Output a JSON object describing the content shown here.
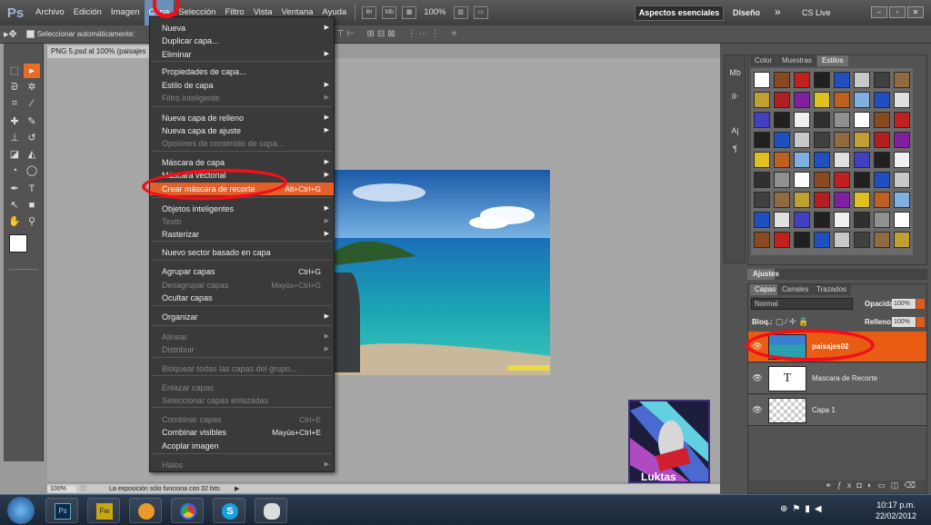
{
  "menubar": {
    "logo": "Ps",
    "items": [
      "Archivo",
      "Edición",
      "Imagen",
      "Capa",
      "Selección",
      "Filtro",
      "Vista",
      "Ventana",
      "Ayuda"
    ],
    "zoom": "100%",
    "workspace": "Aspectos esenciales",
    "design": "Diseño",
    "more": "»",
    "cslive": "CS Live"
  },
  "options": {
    "auto_select": "Seleccionar automáticamente:"
  },
  "document": {
    "tab_title": "PNG 5.psd al 100% (paisajes",
    "status_zoom": "100%",
    "status_text": "La exposición sólo funciona con 32 bits",
    "thumb_name": "Luktas"
  },
  "menu": {
    "items": [
      {
        "label": "Nueva",
        "arrow": true
      },
      {
        "label": "Duplicar capa..."
      },
      {
        "label": "Eliminar",
        "arrow": true
      },
      {
        "label": "Propiedades de capa..."
      },
      {
        "label": "Estilo de capa",
        "arrow": true
      },
      {
        "label": "Filtro inteligente",
        "disabled": true,
        "arrow": true
      },
      {
        "label": "Nueva capa de relleno",
        "arrow": true
      },
      {
        "label": "Nueva capa de ajuste",
        "arrow": true
      },
      {
        "label": "Opciones de contenido de capa...",
        "disabled": true
      },
      {
        "label": "Máscara de capa",
        "arrow": true
      },
      {
        "label": "Máscara vectorial",
        "arrow": true
      },
      {
        "label": "Crear máscara de recorte",
        "shortcut": "Alt+Ctrl+G",
        "highlight": true
      },
      {
        "label": "Objetos inteligentes",
        "arrow": true
      },
      {
        "label": "Texto",
        "disabled": true,
        "arrow": true
      },
      {
        "label": "Rasterizar",
        "arrow": true
      },
      {
        "label": "Nuevo sector basado en capa"
      },
      {
        "label": "Agrupar capas",
        "shortcut": "Ctrl+G"
      },
      {
        "label": "Desagrupar capas",
        "shortcut": "Mayús+Ctrl+G",
        "disabled": true
      },
      {
        "label": "Ocultar capas"
      },
      {
        "label": "Organizar",
        "arrow": true
      },
      {
        "label": "Alinear",
        "disabled": true,
        "arrow": true
      },
      {
        "label": "Distribuir",
        "disabled": true,
        "arrow": true
      },
      {
        "label": "Bloquear todas las capas del grupo...",
        "disabled": true
      },
      {
        "label": "Enlazar capas",
        "disabled": true
      },
      {
        "label": "Seleccionar capas enlazadas",
        "disabled": true
      },
      {
        "label": "Combinar capas",
        "shortcut": "Ctrl+E",
        "disabled": true
      },
      {
        "label": "Combinar visibles",
        "shortcut": "Mayús+Ctrl+E"
      },
      {
        "label": "Acoplar imagen"
      },
      {
        "label": "Halos",
        "disabled": true,
        "arrow": true
      }
    ]
  },
  "styles_panel": {
    "tabs": [
      "Color",
      "Muestras",
      "Estilos"
    ]
  },
  "ajustes": "Ajustes",
  "layers_panel": {
    "tabs": [
      "Capas",
      "Canales",
      "Trazados"
    ],
    "blend_mode": "Normal",
    "opacity_label": "Opacidad:",
    "opacity": "100%",
    "lock_label": "Bloq.:",
    "fill_label": "Relleno:",
    "fill": "100%",
    "layers": [
      {
        "name": "paisajes02",
        "selected": true
      },
      {
        "name": "Mascara de   Recorte",
        "type": "text"
      },
      {
        "name": "Capa 1",
        "type": "empty"
      }
    ]
  },
  "taskbar": {
    "time": "10:17 p.m.",
    "date": "22/02/2012"
  }
}
